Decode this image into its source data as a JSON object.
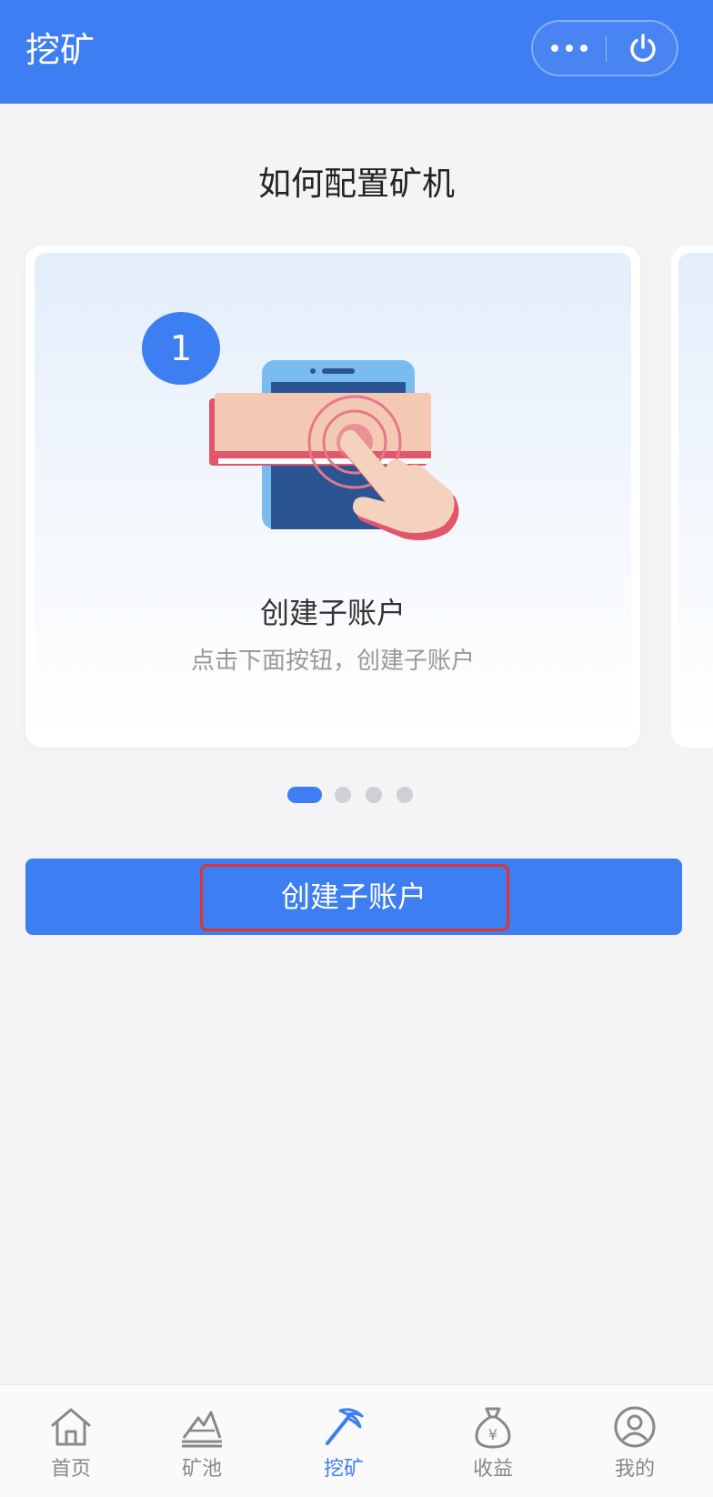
{
  "header": {
    "title": "挖矿"
  },
  "section": {
    "title": "如何配置矿机"
  },
  "carousel": {
    "step_number": "1",
    "card_title": "创建子账户",
    "card_description": "点击下面按钮，创建子账户",
    "pages": 4,
    "active_page": 1
  },
  "primary_button": {
    "label": "创建子账户"
  },
  "tabbar": {
    "items": [
      {
        "label": "首页",
        "icon": "home-icon",
        "active": false
      },
      {
        "label": "矿池",
        "icon": "mining-pool-icon",
        "active": false
      },
      {
        "label": "挖矿",
        "icon": "pickaxe-icon",
        "active": true
      },
      {
        "label": "收益",
        "icon": "money-bag-icon",
        "active": false
      },
      {
        "label": "我的",
        "icon": "profile-icon",
        "active": false
      }
    ]
  },
  "colors": {
    "accent": "#3d7ef2",
    "highlight": "#e5332e",
    "inactive_tab": "#888888"
  }
}
